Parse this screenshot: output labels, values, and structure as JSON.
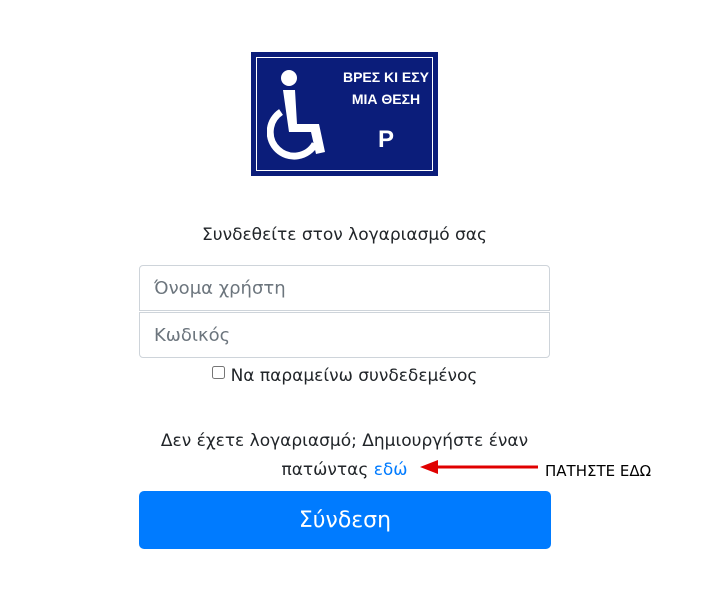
{
  "logo": {
    "line1": "ΒΡΕΣ ΚΙ ΕΣΥ",
    "line2": "ΜΙΑ ΘΕΣΗ",
    "letter": "P",
    "bg_color": "#0b1d7a",
    "icon": "wheelchair-icon"
  },
  "form": {
    "subtitle": "Συνδεθείτε στον λογαριασμό σας",
    "username_placeholder": "Όνομα χρήστη",
    "username_value": "",
    "password_placeholder": "Κωδικός",
    "password_value": "",
    "remember_label": "Να παραμείνω συνδεδεμένος",
    "remember_checked": false,
    "no_account_line1": "Δεν έχετε λογαριασμό; Δημιουργήστε έναν",
    "no_account_line2": "πατώντας",
    "register_link": "εδώ",
    "submit_label": "Σύνδεση",
    "accent_color": "#007bff"
  },
  "annotation": {
    "hint": "ΠΑΤΗΣΤΕ ΕΔΩ",
    "arrow_color": "#e00000"
  }
}
